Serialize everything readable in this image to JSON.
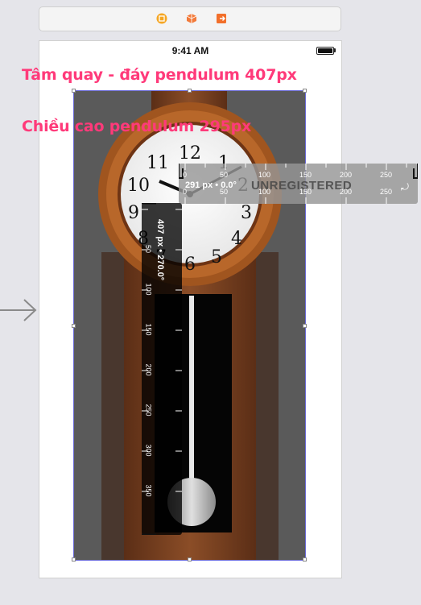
{
  "dock": {
    "icons": [
      "view-controller-icon",
      "first-responder-icon",
      "exit-icon"
    ],
    "colors": {
      "vc": "#f5a623",
      "fr": "#f27a3a",
      "exit": "#f26f2a"
    }
  },
  "status_bar": {
    "time": "9:41 AM"
  },
  "annotations": {
    "pivot_to_bottom": "Tâm quay - đáy pendulum 407px",
    "pendulum_height": "Chiều cao pendulum 295px"
  },
  "ruler_horizontal": {
    "readout": "291 px • 0.0°",
    "ticks_top": [
      "0",
      "50",
      "100",
      "150",
      "200",
      "250"
    ],
    "ticks_bottom": [
      "0",
      "50",
      "100",
      "150",
      "200",
      "250"
    ],
    "watermark": "UNREGISTERED"
  },
  "ruler_vertical": {
    "readout": "407 px • 270.0°",
    "ticks": [
      "50",
      "100",
      "150",
      "200",
      "250",
      "300",
      "350"
    ]
  },
  "colors": {
    "accent": "#ff3a7a",
    "selection": "#6b6bd8",
    "canvas_bg": "#e5e5ea"
  }
}
